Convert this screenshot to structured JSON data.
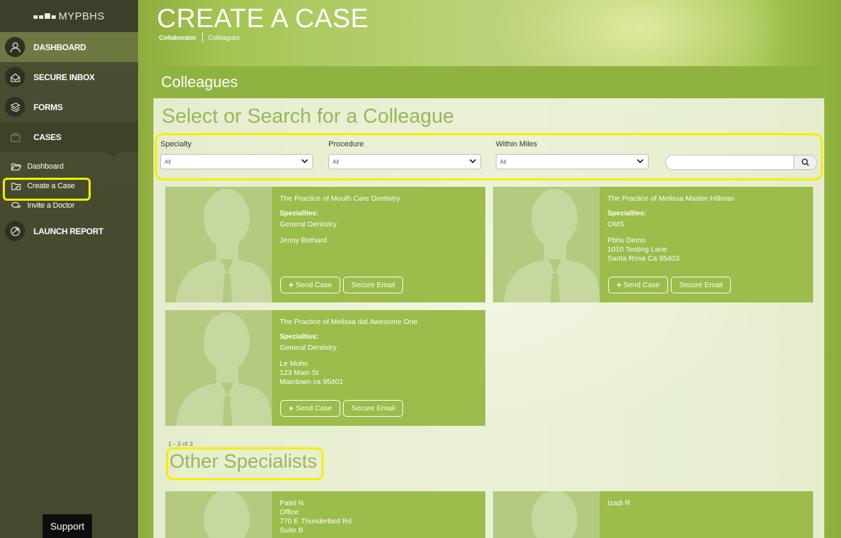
{
  "sidebar": {
    "logo_text": "MYPBHS",
    "nav": [
      {
        "label": "DASHBOARD"
      },
      {
        "label": "SECURE INBOX"
      },
      {
        "label": "FORMS"
      },
      {
        "label": "CASES"
      },
      {
        "label": "LAUNCH REPORT"
      }
    ],
    "sub_items": [
      {
        "label": "Dashboard"
      },
      {
        "label": "Create a Case"
      },
      {
        "label": "Invite a Doctor"
      }
    ],
    "support_label": "Support"
  },
  "header": {
    "title": "CREATE A CASE",
    "breadcrumb": [
      "Collaborator",
      "Colleagues"
    ]
  },
  "panel": {
    "title": "Colleagues",
    "section_title": "Select or Search for a Colleague",
    "filters": [
      {
        "label": "Specialty",
        "value": "All"
      },
      {
        "label": "Procedure",
        "value": "All"
      },
      {
        "label": "Within Miles",
        "value": "All"
      }
    ],
    "search": {
      "value": "",
      "placeholder": ""
    },
    "send_case_label": "Send Case",
    "secure_email_label": "Secure Email",
    "specialties_label": "Specialties:",
    "colleagues": [
      {
        "name": "The Practice of Mouth Care Dentistry",
        "specialty": "General Dentistry",
        "address": [
          "Jenny Bethard"
        ]
      },
      {
        "name": "The Practice of Melissa Master Hillman",
        "specialty": "OMS",
        "address": [
          "Pbhs Demo",
          "1010 Testing Lane",
          "Santa Rosa Ca 95403"
        ]
      },
      {
        "name": "The Practice of Melissa dat Awesome One",
        "specialty": "General Dentistry",
        "address": [
          "Le Mohn",
          "123 Main St",
          "Maintown ca 95401"
        ]
      }
    ],
    "pager_text": "1 - 3 of 3",
    "other_title": "Other Specialists",
    "others": [
      {
        "lines": [
          "Patel N",
          "Office",
          "770 E Thunderbird Rd",
          "Suite B"
        ]
      },
      {
        "lines": [
          "Izadi R"
        ]
      }
    ]
  },
  "colors": {
    "accent_green": "#8eb341",
    "card_green": "#9cbc4b",
    "highlight_yellow": "#f5ee00",
    "sidebar_dark": "#464b30"
  }
}
